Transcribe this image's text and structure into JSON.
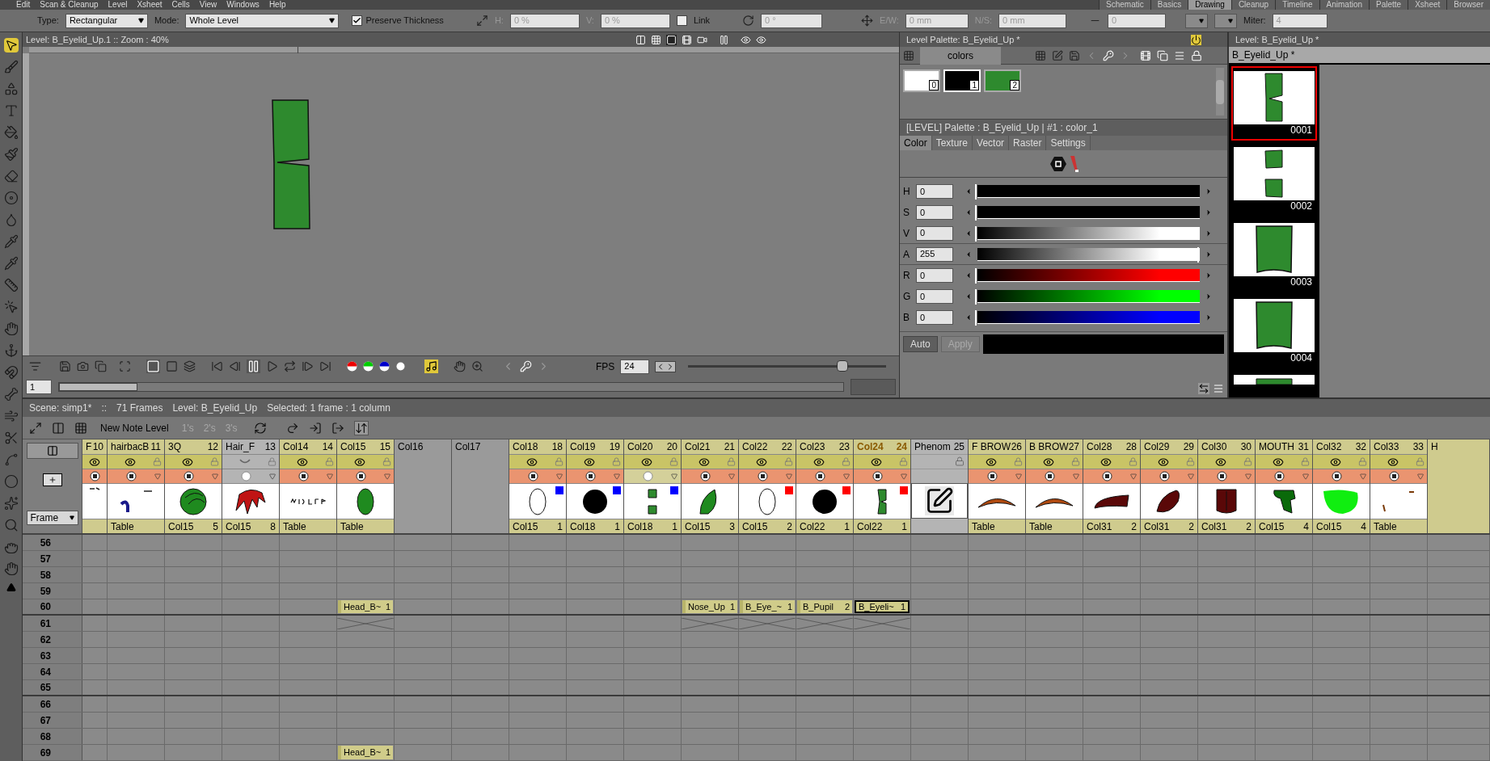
{
  "menu_bar": {
    "items": [
      "Edit",
      "Scan & Cleanup",
      "Level",
      "Xsheet",
      "Cells",
      "View",
      "Windows",
      "Help"
    ]
  },
  "rooms": [
    {
      "label": "Schematic",
      "selected": false
    },
    {
      "label": "Basics",
      "selected": false
    },
    {
      "label": "Drawing",
      "selected": true
    },
    {
      "label": "Cleanup",
      "selected": false
    },
    {
      "label": "Timeline",
      "selected": false
    },
    {
      "label": "Animation",
      "selected": false
    },
    {
      "label": "Palette",
      "selected": false
    },
    {
      "label": "Xsheet",
      "selected": false
    },
    {
      "label": "Browser",
      "selected": false
    }
  ],
  "tool_options": {
    "type_label": "Type:",
    "type_value": "Rectangular",
    "mode_label": "Mode:",
    "mode_value": "Whole Level",
    "preserve_thickness": {
      "label": "Preserve Thickness",
      "checked": true
    },
    "h_label": "H:",
    "h_value": "0 %",
    "v_label": "V:",
    "v_value": "0 %",
    "link": {
      "label": "Link",
      "checked": false
    },
    "rotation_value": "0 °",
    "ew_label": "E/W:",
    "ew_value": "0 mm",
    "ns_label": "N/S:",
    "ns_value": "0 mm",
    "thickness_value": "0",
    "miter_label": "Miter:",
    "miter_value": "4"
  },
  "tools": [
    {
      "selected": true
    },
    {
      "selected": false
    },
    {
      "selected": false
    },
    {
      "selected": false
    },
    {
      "selected": false
    },
    {
      "selected": false
    },
    {
      "selected": false
    },
    {
      "selected": false
    },
    {
      "selected": false
    },
    {
      "selected": false
    },
    {
      "selected": false
    },
    {
      "selected": false
    },
    {
      "selected": false
    },
    {
      "selected": false
    },
    {
      "selected": false
    },
    {
      "selected": false
    },
    {
      "selected": false
    },
    {
      "selected": false
    },
    {
      "selected": false
    },
    {
      "selected": false
    },
    {
      "selected": false
    },
    {
      "selected": false
    },
    {
      "selected": false
    },
    {
      "selected": false
    },
    {
      "selected": false
    }
  ],
  "viewer": {
    "title": "Level: B_Eyelid_Up.1  ::  Zoom : 40%",
    "fps_label": "FPS",
    "fps_value": "24",
    "fps_slider": {
      "level": 0.78
    },
    "frame_value": "1",
    "frame_slider": {
      "level": 0.1
    }
  },
  "level_palette": {
    "title": "Level Palette: B_Eyelid_Up *",
    "page_tab": "colors",
    "chips": [
      {
        "index": "0",
        "color": "#ffffff",
        "selected": false
      },
      {
        "index": "1",
        "color": "#000000",
        "selected": true
      },
      {
        "index": "2",
        "color": "#2e8a2e",
        "selected": false
      }
    ]
  },
  "style_editor": {
    "title": "[LEVEL]  Palette : B_Eyelid_Up | #1 : color_1",
    "tabs": [
      {
        "label": "Color",
        "selected": true
      },
      {
        "label": "Texture",
        "selected": false
      },
      {
        "label": "Vector",
        "selected": false
      },
      {
        "label": "Raster",
        "selected": false
      },
      {
        "label": "Settings",
        "selected": false
      }
    ],
    "channels": [
      {
        "name": "H",
        "value": "0",
        "level": 0,
        "color": "#000000"
      },
      {
        "name": "S",
        "value": "0",
        "level": 0,
        "color": "#000000"
      },
      {
        "name": "V",
        "value": "0",
        "level": 0,
        "color": "#ffffff"
      },
      {
        "name": "A",
        "value": "255",
        "level": 1,
        "color": "#ffffff"
      },
      {
        "name": "R",
        "value": "0",
        "level": 0,
        "color": "#ff0000"
      },
      {
        "name": "G",
        "value": "0",
        "level": 0,
        "color": "#00ff00"
      },
      {
        "name": "B",
        "value": "0",
        "level": 0,
        "color": "#0000ff"
      }
    ],
    "auto_button": {
      "label": "Auto",
      "on": true
    },
    "apply_button": {
      "label": "Apply",
      "disabled": true
    }
  },
  "level_strip": {
    "title": "Level:  B_Eyelid_Up *",
    "level_name": "B_Eyelid_Up *",
    "frames": [
      {
        "number": "0001",
        "kind": "notched",
        "selected": true
      },
      {
        "number": "0002",
        "kind": "split",
        "selected": false
      },
      {
        "number": "0003",
        "kind": "panel",
        "selected": false
      },
      {
        "number": "0004",
        "kind": "panel",
        "selected": false
      },
      {
        "kind": "partial",
        "selected": false
      }
    ]
  },
  "xsheet": {
    "status": [
      "Scene: simp1*",
      "::",
      "71 Frames",
      "Level: B_Eyelid_Up",
      "Selected: 1 frame : 1 column"
    ],
    "new_note_level": "New Note Level",
    "step_buttons": [
      {
        "label": "1's",
        "disabled": true
      },
      {
        "label": "2's",
        "disabled": true
      },
      {
        "label": "3's",
        "disabled": true
      }
    ],
    "frame_mode": "Frame",
    "columns": [
      {
        "kind": "level",
        "name": "F",
        "number": "10",
        "preview": true,
        "camstand": true,
        "thumb": {
          "kind": "marks"
        }
      },
      {
        "kind": "level",
        "name": "hairbacB",
        "number": "11",
        "preview": true,
        "camstand": true,
        "thumb": {
          "kind": "hook"
        },
        "source": "Table"
      },
      {
        "kind": "level",
        "name": "3Q",
        "number": "12",
        "preview": true,
        "camstand": true,
        "thumb": {
          "kind": "head"
        },
        "source": "Col15",
        "source_frame": "5"
      },
      {
        "kind": "level",
        "name": "Hair_F",
        "number": "13",
        "preview": false,
        "camstand": false,
        "thumb": {
          "kind": "hair"
        },
        "source": "Col15",
        "source_frame": "8"
      },
      {
        "kind": "level",
        "name": "Col14",
        "number": "14",
        "preview": true,
        "camstand": true,
        "thumb": {
          "kind": "scribble"
        },
        "source": "Table"
      },
      {
        "kind": "level",
        "name": "Col15",
        "number": "15",
        "preview": true,
        "camstand": true,
        "thumb": {
          "kind": "oval-green"
        },
        "source": "Table"
      },
      {
        "kind": "empty",
        "name": "Col16"
      },
      {
        "kind": "empty",
        "name": "Col17"
      },
      {
        "kind": "level",
        "name": "Col18",
        "number": "18",
        "preview": true,
        "camstand": true,
        "thumb": {
          "kind": "oval-outline"
        },
        "color": "#0000ff",
        "source": "Col15",
        "source_frame": "1"
      },
      {
        "kind": "level",
        "name": "Col19",
        "number": "19",
        "preview": true,
        "camstand": true,
        "thumb": {
          "kind": "disc"
        },
        "color": "#0000ff",
        "source": "Col18",
        "source_frame": "1"
      },
      {
        "kind": "level",
        "name": "Col20",
        "number": "20",
        "preview": true,
        "camstand": false,
        "thumb": {
          "kind": "squares"
        },
        "color": "#0000ff",
        "source": "Col18",
        "source_frame": "1"
      },
      {
        "kind": "level",
        "name": "Col21",
        "number": "21",
        "preview": true,
        "camstand": true,
        "thumb": {
          "kind": "leaf"
        },
        "source": "Col15",
        "source_frame": "3"
      },
      {
        "kind": "level",
        "name": "Col22",
        "number": "22",
        "preview": true,
        "camstand": true,
        "thumb": {
          "kind": "oval-outline"
        },
        "color": "#ff0000",
        "source": "Col15",
        "source_frame": "2"
      },
      {
        "kind": "level",
        "name": "Col23",
        "number": "23",
        "preview": true,
        "camstand": true,
        "thumb": {
          "kind": "disc"
        },
        "color": "#ff0000",
        "source": "Col22",
        "source_frame": "1"
      },
      {
        "kind": "level",
        "name": "Col24",
        "number": "24",
        "current": true,
        "preview": true,
        "camstand": true,
        "thumb": {
          "kind": "notched"
        },
        "color": "#ff0000",
        "source": "Col22",
        "source_frame": "1"
      },
      {
        "kind": "note",
        "name": "Phenom",
        "number": "25"
      },
      {
        "kind": "level",
        "name": "F BROW",
        "number": "26",
        "preview": true,
        "camstand": true,
        "thumb": {
          "kind": "brow"
        },
        "source": "Table"
      },
      {
        "kind": "level",
        "name": "B BROW",
        "number": "27",
        "preview": true,
        "camstand": true,
        "thumb": {
          "kind": "brow"
        },
        "source": "Table"
      },
      {
        "kind": "level",
        "name": "Col28",
        "number": "28",
        "preview": true,
        "camstand": true,
        "thumb": {
          "kind": "lip"
        },
        "source": "Col31",
        "source_frame": "2"
      },
      {
        "kind": "level",
        "name": "Col29",
        "number": "29",
        "preview": true,
        "camstand": true,
        "thumb": {
          "kind": "lip-tilt"
        },
        "source": "Col31",
        "source_frame": "2"
      },
      {
        "kind": "level",
        "name": "Col30",
        "number": "30",
        "preview": true,
        "camstand": true,
        "thumb": {
          "kind": "tongue"
        },
        "source": "Col31",
        "source_frame": "2"
      },
      {
        "kind": "level",
        "name": "MOUTH",
        "number": "31",
        "preview": true,
        "camstand": true,
        "thumb": {
          "kind": "mouth"
        },
        "source": "Col15",
        "source_frame": "4"
      },
      {
        "kind": "level",
        "name": "Col32",
        "number": "32",
        "preview": true,
        "camstand": true,
        "thumb": {
          "kind": "lime"
        },
        "source": "Col15",
        "source_frame": "4"
      },
      {
        "kind": "level",
        "name": "Col33",
        "number": "33",
        "preview": true,
        "camstand": true,
        "thumb": {
          "kind": "dash"
        },
        "source": "Table"
      },
      {
        "kind": "partial",
        "name": "H"
      }
    ],
    "rows": [
      {
        "frame": "56",
        "marker": false,
        "cells": [
          null,
          null,
          null,
          null,
          null,
          null,
          null,
          null,
          null,
          null,
          null,
          null,
          null,
          null,
          null,
          null,
          null,
          null,
          null,
          null,
          null,
          null,
          null,
          null,
          null
        ]
      },
      {
        "frame": "57",
        "marker": false,
        "cells": [
          null,
          null,
          null,
          null,
          null,
          null,
          null,
          null,
          null,
          null,
          null,
          null,
          null,
          null,
          null,
          null,
          null,
          null,
          null,
          null,
          null,
          null,
          null,
          null,
          null
        ]
      },
      {
        "frame": "58",
        "marker": false,
        "cells": [
          null,
          null,
          null,
          null,
          null,
          null,
          null,
          null,
          null,
          null,
          null,
          null,
          null,
          null,
          null,
          null,
          null,
          null,
          null,
          null,
          null,
          null,
          null,
          null,
          null
        ]
      },
      {
        "frame": "59",
        "marker": false,
        "cells": [
          null,
          null,
          null,
          null,
          null,
          null,
          null,
          null,
          null,
          null,
          null,
          null,
          null,
          null,
          null,
          null,
          null,
          null,
          null,
          null,
          null,
          null,
          null,
          null,
          null
        ]
      },
      {
        "frame": "60",
        "marker": true,
        "cells": [
          null,
          null,
          null,
          null,
          null,
          {
            "kind": "level",
            "name": "Head_B~",
            "frame": "1",
            "selected": false
          },
          null,
          null,
          null,
          null,
          null,
          {
            "kind": "level",
            "name": "Nose_Up",
            "frame": "1",
            "selected": false
          },
          {
            "kind": "level",
            "name": "B_Eye_~",
            "frame": "1",
            "selected": false
          },
          {
            "kind": "level",
            "name": "B_Pupil",
            "frame": "2",
            "selected": false
          },
          {
            "kind": "level",
            "name": "B_Eyeli~",
            "frame": "1",
            "selected": true
          },
          null,
          null,
          null,
          null,
          null,
          null,
          null,
          null,
          null,
          null
        ]
      },
      {
        "frame": "61",
        "marker": false,
        "cells": [
          null,
          null,
          null,
          null,
          null,
          {
            "kind": "end"
          },
          null,
          null,
          null,
          null,
          null,
          {
            "kind": "end"
          },
          {
            "kind": "end"
          },
          {
            "kind": "end"
          },
          {
            "kind": "end"
          },
          null,
          null,
          null,
          null,
          null,
          null,
          null,
          null,
          null,
          null
        ]
      },
      {
        "frame": "62",
        "marker": false,
        "cells": [
          null,
          null,
          null,
          null,
          null,
          null,
          null,
          null,
          null,
          null,
          null,
          null,
          null,
          null,
          null,
          null,
          null,
          null,
          null,
          null,
          null,
          null,
          null,
          null,
          null
        ]
      },
      {
        "frame": "63",
        "marker": false,
        "cells": [
          null,
          null,
          null,
          null,
          null,
          null,
          null,
          null,
          null,
          null,
          null,
          null,
          null,
          null,
          null,
          null,
          null,
          null,
          null,
          null,
          null,
          null,
          null,
          null,
          null
        ]
      },
      {
        "frame": "64",
        "marker": false,
        "cells": [
          null,
          null,
          null,
          null,
          null,
          null,
          null,
          null,
          null,
          null,
          null,
          null,
          null,
          null,
          null,
          null,
          null,
          null,
          null,
          null,
          null,
          null,
          null,
          null,
          null
        ]
      },
      {
        "frame": "65",
        "marker": true,
        "cells": [
          null,
          null,
          null,
          null,
          null,
          null,
          null,
          null,
          null,
          null,
          null,
          null,
          null,
          null,
          null,
          null,
          null,
          null,
          null,
          null,
          null,
          null,
          null,
          null,
          null
        ]
      },
      {
        "frame": "66",
        "marker": false,
        "cells": [
          null,
          null,
          null,
          null,
          null,
          null,
          null,
          null,
          null,
          null,
          null,
          null,
          null,
          null,
          null,
          null,
          null,
          null,
          null,
          null,
          null,
          null,
          null,
          null,
          null
        ]
      },
      {
        "frame": "67",
        "marker": false,
        "cells": [
          null,
          null,
          null,
          null,
          null,
          null,
          null,
          null,
          null,
          null,
          null,
          null,
          null,
          null,
          null,
          null,
          null,
          null,
          null,
          null,
          null,
          null,
          null,
          null,
          null
        ]
      },
      {
        "frame": "68",
        "marker": false,
        "cells": [
          null,
          null,
          null,
          null,
          null,
          null,
          null,
          null,
          null,
          null,
          null,
          null,
          null,
          null,
          null,
          null,
          null,
          null,
          null,
          null,
          null,
          null,
          null,
          null,
          null
        ]
      },
      {
        "frame": "69",
        "marker": false,
        "cells": [
          null,
          null,
          null,
          null,
          null,
          {
            "kind": "level",
            "name": "Head_B~",
            "frame": "1",
            "selected": false
          },
          null,
          null,
          null,
          null,
          null,
          null,
          null,
          null,
          null,
          null,
          null,
          null,
          null,
          null,
          null,
          null,
          null,
          null,
          null
        ]
      }
    ]
  }
}
